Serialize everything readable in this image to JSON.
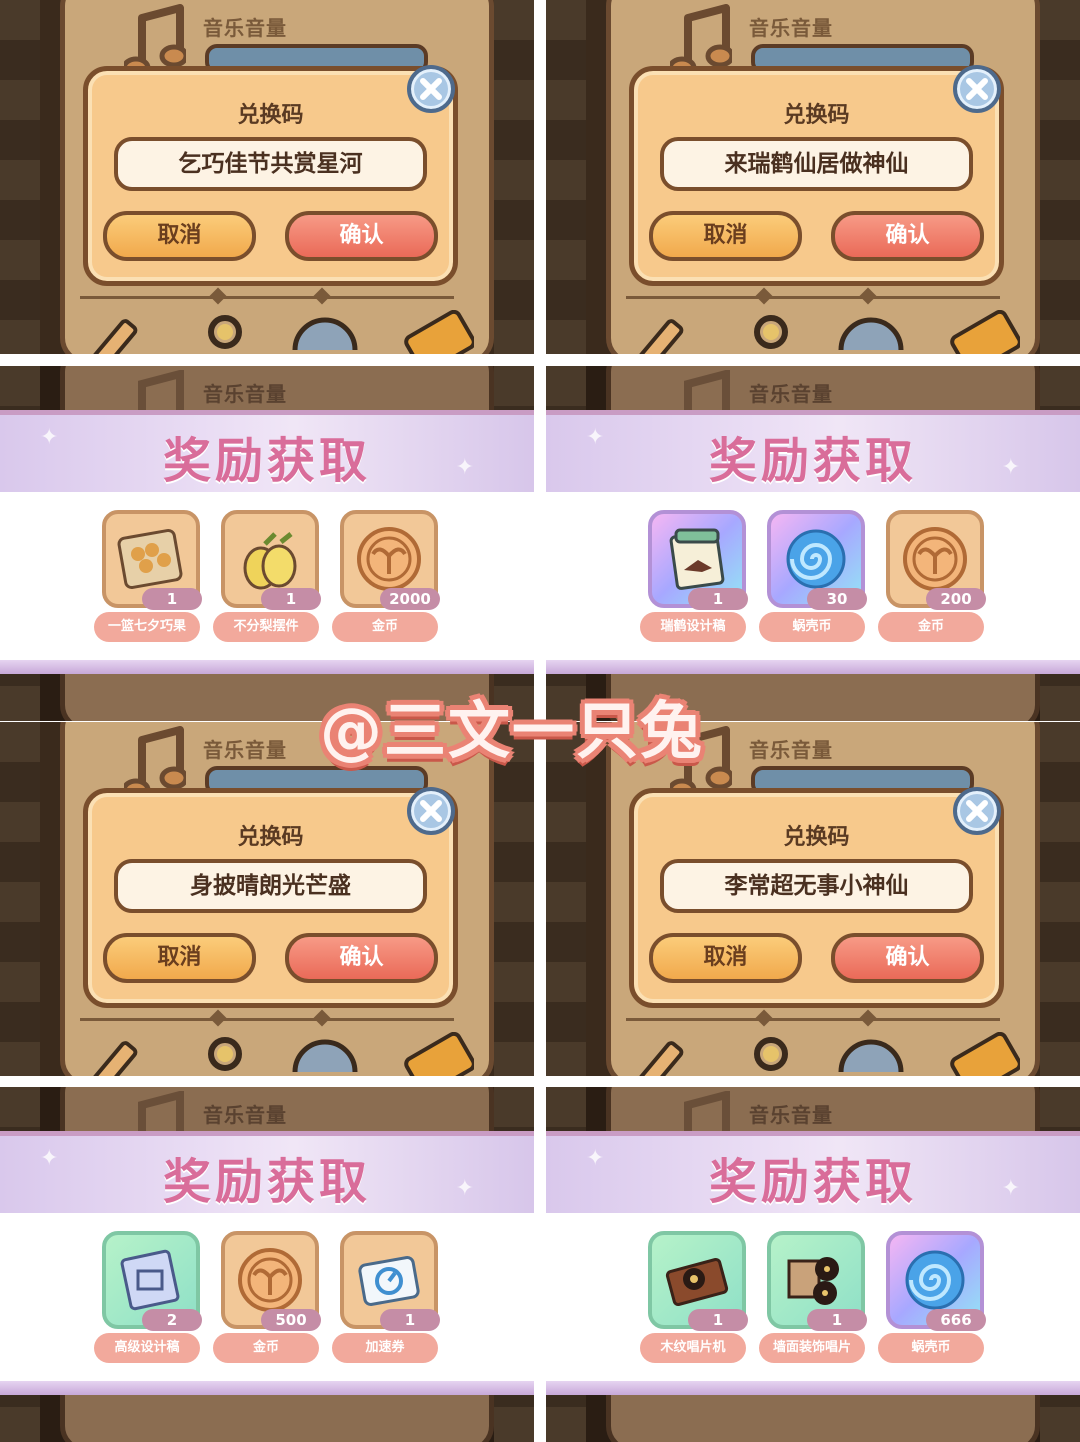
{
  "colors": {
    "accent": "#ea6a58",
    "reward_title": "#d96d9a",
    "dialog": "#f7c98c",
    "watermark_stroke": "#ea8374"
  },
  "background": {
    "music_label": "音乐音量"
  },
  "redeem_dialogs": [
    {
      "title": "兑换码",
      "code": "乞巧佳节共赏星河",
      "cancel_label": "取消",
      "confirm_label": "确认"
    },
    {
      "title": "兑换码",
      "code": "来瑞鹤仙居做神仙",
      "cancel_label": "取消",
      "confirm_label": "确认"
    },
    {
      "title": "兑换码",
      "code": "身披晴朗光芒盛",
      "cancel_label": "取消",
      "confirm_label": "确认"
    },
    {
      "title": "兑换码",
      "code": "李常超无事小神仙",
      "cancel_label": "取消",
      "confirm_label": "确认"
    }
  ],
  "rewards": [
    {
      "title": "奖励获取",
      "items": [
        {
          "name": "一篮七夕巧果",
          "qty": "1",
          "icon": "pastry-basket-icon"
        },
        {
          "name": "不分梨摆件",
          "qty": "1",
          "icon": "pear-pair-icon"
        },
        {
          "name": "金币",
          "qty": "2000",
          "icon": "gold-coin-icon"
        }
      ]
    },
    {
      "title": "奖励获取",
      "items": [
        {
          "name": "瑞鹤设计稿",
          "qty": "1",
          "icon": "crane-blueprint-icon"
        },
        {
          "name": "蜗壳币",
          "qty": "30",
          "icon": "snail-shell-coin-icon"
        },
        {
          "name": "金币",
          "qty": "200",
          "icon": "gold-coin-icon"
        }
      ]
    },
    {
      "title": "奖励获取",
      "items": [
        {
          "name": "高级设计稿",
          "qty": "2",
          "icon": "blueprint-scroll-icon"
        },
        {
          "name": "金币",
          "qty": "500",
          "icon": "gold-coin-icon"
        },
        {
          "name": "加速券",
          "qty": "1",
          "icon": "speed-ticket-icon"
        }
      ]
    },
    {
      "title": "奖励获取",
      "items": [
        {
          "name": "木纹唱片机",
          "qty": "1",
          "icon": "wood-record-player-icon"
        },
        {
          "name": "墙面装饰唱片",
          "qty": "1",
          "icon": "wall-record-decor-icon"
        },
        {
          "name": "蜗壳币",
          "qty": "666",
          "icon": "snail-shell-coin-icon"
        }
      ]
    }
  ],
  "watermark": "@三文一只兔"
}
